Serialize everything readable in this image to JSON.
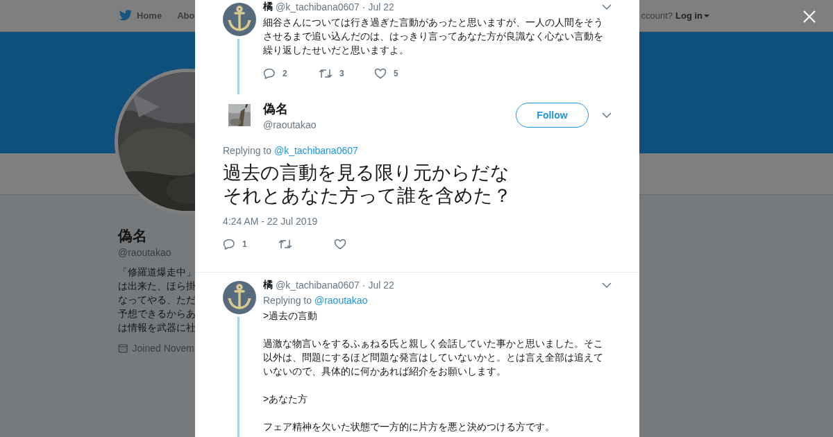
{
  "nav": {
    "items": [
      {
        "label": "Home",
        "kind": "bird"
      },
      {
        "label": "Abo",
        "kind": "plain"
      }
    ],
    "account_prompt": "ccount?",
    "login": "Log in"
  },
  "profile": {
    "name": "偽名",
    "handle": "@raoutakao",
    "bio_lines": [
      "「修羅道爆走中」",
      "は出来た、ほら掛",
      "なってやる、ただ",
      "予想できるからあ",
      "は情報を武器に社"
    ],
    "joined": "Joined Novem"
  },
  "tweets": [
    {
      "kind": "parent",
      "name": "橘",
      "handle": "@k_tachibana0607",
      "date": "· Jul 22",
      "paragraphs": [
        "細谷さんについては行き過ぎた言動があったと思いますが、一人の人間をそうさせるまで追い込んだのは、はっきり言ってあなた方が良識なく心ない言動を繰り返したせいだと思いますよ。"
      ],
      "actions": [
        {
          "kind": "reply",
          "count": "2"
        },
        {
          "kind": "retweet",
          "count": "3"
        },
        {
          "kind": "like",
          "count": "5"
        }
      ]
    },
    {
      "kind": "main",
      "name": "偽名",
      "handle": "@raoutakao",
      "follow": "Follow",
      "replying_prefix": "Replying to",
      "replying_to": "@k_tachibana0607",
      "text_lines": [
        "過去の言動を見る限り元からだな",
        "それとあなた方って誰を含めた？"
      ],
      "timestamp": "4:24 AM - 22 Jul 2019",
      "actions": [
        {
          "kind": "reply",
          "count": "1"
        },
        {
          "kind": "retweet"
        },
        {
          "kind": "like"
        }
      ]
    },
    {
      "kind": "parent",
      "name": "橘",
      "handle": "@k_tachibana0607",
      "date": "· Jul 22",
      "replying_prefix": "Replying to",
      "replying_to": "@raoutakao",
      "paragraphs": [
        ">過去の言動",
        "過激な物言いをするふぁねる氏と親しく会話していた事かと思いました。そこ以外は、問題にするほど問題な発言はしていないかと。とは言え全部は追えていないので、具体的に何かあれば紹介をお願いします。",
        ">あなた方",
        "フェア精神を欠いた状態で一方的に片方を悪と決めつける方です。"
      ]
    }
  ]
}
